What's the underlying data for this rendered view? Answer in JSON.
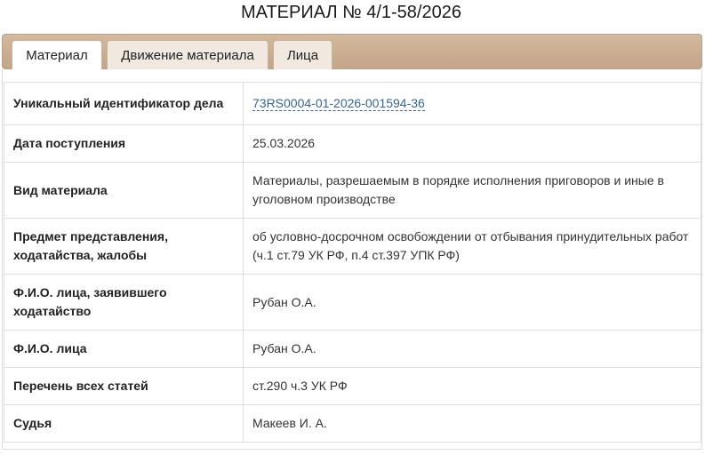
{
  "page": {
    "title": "МАТЕРИАЛ № 4/1-58/2026"
  },
  "tabs": [
    {
      "label": "Материал",
      "active": true
    },
    {
      "label": "Движение материала",
      "active": false
    },
    {
      "label": "Лица",
      "active": false
    }
  ],
  "rows": [
    {
      "label": "Уникальный идентификатор дела",
      "value": "73RS0004-01-2026-001594-36",
      "is_link": true
    },
    {
      "label": "Дата поступления",
      "value": "25.03.2026"
    },
    {
      "label": "Вид материала",
      "value": "Материалы, разрешаемым в порядке исполнения приговоров и иные в уголовном производстве"
    },
    {
      "label": "Предмет представления, ходатайства, жалобы",
      "value": "об условно-досрочном освобождении от отбывания принудительных работ (ч.1 ст.79 УК РФ, п.4 ст.397 УПК РФ)"
    },
    {
      "label": "Ф.И.О. лица, заявившего ходатайство",
      "value": "Рубан О.А."
    },
    {
      "label": "Ф.И.О. лица",
      "value": "Рубан О.А."
    },
    {
      "label": "Перечень всех статей",
      "value": "ст.290 ч.3 УК РФ"
    },
    {
      "label": "Судья",
      "value": "Макеев И. А."
    }
  ],
  "colors": {
    "tab_bar": "#c3a587",
    "link": "#336699"
  }
}
